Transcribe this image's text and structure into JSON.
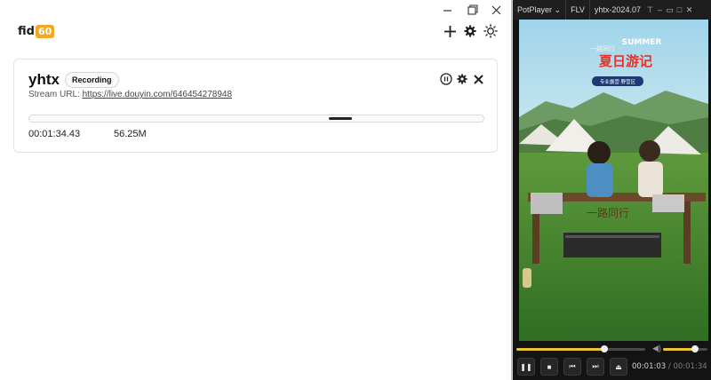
{
  "logo": {
    "text_main": "fid",
    "text_box": "60"
  },
  "stream": {
    "name": "yhtx",
    "status": "Recording",
    "url_label": "Stream URL:",
    "url": "https://live.douyin.com/646454278948",
    "progress_fraction": 0.05,
    "elapsed": "00:01:34.43",
    "size": "56.25M"
  },
  "player": {
    "app_name": "PotPlayer",
    "format": "FLV",
    "file_title": "yhtx-2024.07",
    "seek_fraction": 0.68,
    "volume_fraction": 0.72,
    "current_time": "00:01:03",
    "separator": "/",
    "total_time": "00:01:34"
  },
  "overlay": {
    "title_cn": "夏日游记",
    "title_en": "SUMMER",
    "banner_cn": "一路同行",
    "location": "专业露营·野营区"
  },
  "icons": {
    "minimize": "minimize-icon",
    "maximize": "maximize-icon",
    "close": "close-icon",
    "add": "plus-icon",
    "settings": "gear-icon",
    "theme": "sun-icon",
    "pause": "pause-circle-icon"
  }
}
